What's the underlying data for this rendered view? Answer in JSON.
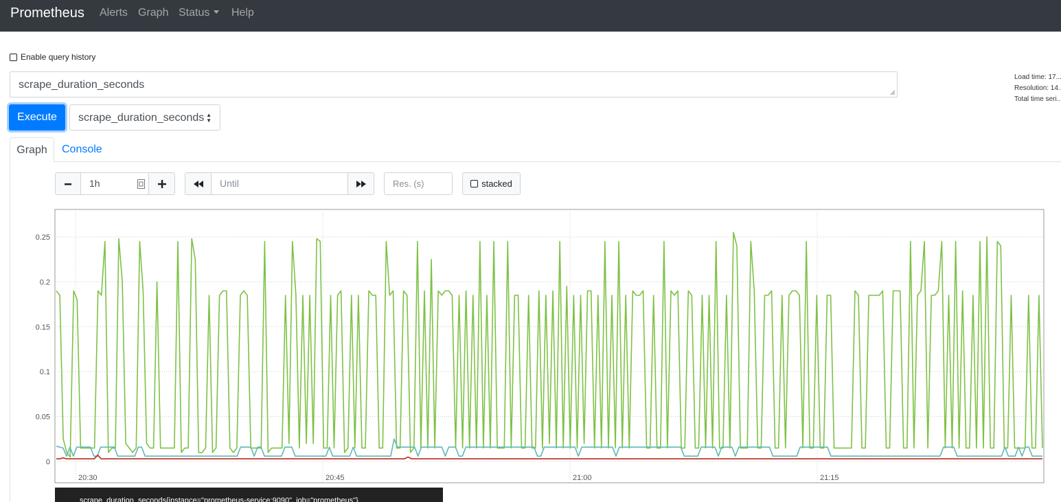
{
  "navbar": {
    "brand": "Prometheus",
    "links": [
      "Alerts",
      "Graph",
      "Status",
      "Help"
    ]
  },
  "query_history": {
    "label": "Enable query history",
    "checked": false
  },
  "expression": {
    "value": "scrape_duration_seconds"
  },
  "execute": {
    "label": "Execute"
  },
  "metric_select": {
    "value": "scrape_duration_seconds"
  },
  "stats": {
    "load_time": "Load time: 17...",
    "resolution": "Resolution: 14...",
    "total_series": "Total time seri..."
  },
  "tabs": {
    "graph": "Graph",
    "console": "Console"
  },
  "graph_controls": {
    "range": "1h",
    "until_placeholder": "Until",
    "res_placeholder": "Res. (s)",
    "stacked_label": "stacked"
  },
  "legend": {
    "text": "scrape_duration_seconds{instance=\"prometheus-service:9090\", job=\"prometheus\"}"
  },
  "colors": {
    "green": "#7dc145",
    "teal": "#5fb9b4",
    "red": "#c0392b",
    "navbar": "#343a40",
    "primary": "#007bff"
  },
  "chart_data": {
    "type": "line",
    "x_tick_labels": [
      "20:30",
      "20:45",
      "21:00",
      "21:15"
    ],
    "y_tick_labels": [
      "0",
      "0.05",
      "0.1",
      "0.15",
      "0.2",
      "0.25"
    ],
    "ylim": [
      0,
      0.28
    ],
    "grid": true,
    "x_start": "20:27",
    "x_step_seconds": 15,
    "series": [
      {
        "color": "#7dc145",
        "values": [
          0.19,
          0.185,
          0.025,
          0.01,
          0.005,
          0.19,
          0.18,
          0.015,
          0.015,
          0.015,
          0.015,
          0.015,
          0.19,
          0.185,
          0.245,
          0.01,
          0.015,
          0.015,
          0.248,
          0.2,
          0.02,
          0.015,
          0.01,
          0.015,
          0.245,
          0.19,
          0.02,
          0.015,
          0.015,
          0.2,
          0.015,
          0.015,
          0.015,
          0.015,
          0.015,
          0.245,
          0.01,
          0.015,
          0.015,
          0.248,
          0.225,
          0.01,
          0.01,
          0.015,
          0.185,
          0.01,
          0.015,
          0.185,
          0.19,
          0.19,
          0.015,
          0.01,
          0.015,
          0.185,
          0.19,
          0.185,
          0.015,
          0.015,
          0.015,
          0.015,
          0.245,
          0.01,
          0.015,
          0.015,
          0.015,
          0.015,
          0.185,
          0.02,
          0.245,
          0.185,
          0.015,
          0.185,
          0.02,
          0.185,
          0.02,
          0.248,
          0.245,
          0.015,
          0.015,
          0.185,
          0.015,
          0.185,
          0.19,
          0.01,
          0.015,
          0.185,
          0.015,
          0.185,
          0.015,
          0.015,
          0.19,
          0.185,
          0.185,
          0.015,
          0.015,
          0.245,
          0.185,
          0.19,
          0.015,
          0.015,
          0.19,
          0.185,
          0.01,
          0.015,
          0.245,
          0.015,
          0.19,
          0.015,
          0.225,
          0.015,
          0.19,
          0.185,
          0.19,
          0.19,
          0.185,
          0.015,
          0.185,
          0.015,
          0.19,
          0.015,
          0.185,
          0.015,
          0.245,
          0.015,
          0.185,
          0.015,
          0.245,
          0.015,
          0.015,
          0.015,
          0.245,
          0.015,
          0.185,
          0.185,
          0.015,
          0.015,
          0.185,
          0.015,
          0.015,
          0.19,
          0.015,
          0.185,
          0.02,
          0.19,
          0.015,
          0.245,
          0.015,
          0.195,
          0.015,
          0.185,
          0.015,
          0.185,
          0.02,
          0.19,
          0.19,
          0.015,
          0.185,
          0.015,
          0.245,
          0.015,
          0.185,
          0.015,
          0.245,
          0.015,
          0.185,
          0.015,
          0.19,
          0.185,
          0.185,
          0.19,
          0.015,
          0.015,
          0.185,
          0.015,
          0.015,
          0.245,
          0.015,
          0.19,
          0.185,
          0.19,
          0.015,
          0.015,
          0.19,
          0.185,
          0.015,
          0.015,
          0.185,
          0.015,
          0.185,
          0.015,
          0.245,
          0.015,
          0.015,
          0.185,
          0.015,
          0.255,
          0.24,
          0.015,
          0.015,
          0.015,
          0.245,
          0.19,
          0.015,
          0.015,
          0.185,
          0.185,
          0.19,
          0.015,
          0.015,
          0.185,
          0.015,
          0.185,
          0.19,
          0.19,
          0.185,
          0.015,
          0.245,
          0.015,
          0.015,
          0.185,
          0.015,
          0.015,
          0.185,
          0.185,
          0.015,
          0.015,
          0.015,
          0.015,
          0.015,
          0.015,
          0.19,
          0.185,
          0.015,
          0.015,
          0.185,
          0.185,
          0.185,
          0.185,
          0.19,
          0.015,
          0.015,
          0.19,
          0.19,
          0.19,
          0.015,
          0.015,
          0.245,
          0.015,
          0.185,
          0.19,
          0.245,
          0.015,
          0.185,
          0.185,
          0.19,
          0.245,
          0.015,
          0.185,
          0.015,
          0.245,
          0.015,
          0.19,
          0.015,
          0.015,
          0.185,
          0.015,
          0.245,
          0.015,
          0.25,
          0.015,
          0.015,
          0.245,
          0.24,
          0.015,
          0.015,
          0.185,
          0.015,
          0.015,
          0.015,
          0.015,
          0.185,
          0.015,
          0.015,
          0.185,
          0.015
        ]
      },
      {
        "color": "#5fb9b4",
        "values": [
          0.017,
          0.016,
          0.015,
          0.006,
          0.016,
          0.006,
          0.016,
          0.016,
          0.016,
          0.016,
          0.016,
          0.006,
          0.006,
          0.016,
          0.016,
          0.016,
          0.016,
          0.016,
          0.006,
          0.006,
          0.006,
          0.006,
          0.006,
          0.006,
          0.016,
          0.016,
          0.006,
          0.006,
          0.006,
          0.006,
          0.006,
          0.006,
          0.006,
          0.006,
          0.006,
          0.006,
          0.006,
          0.006,
          0.006,
          0.006,
          0.006,
          0.006,
          0.006,
          0.006,
          0.006,
          0.006,
          0.006,
          0.006,
          0.006,
          0.006,
          0.006,
          0.006,
          0.006,
          0.006,
          0.016,
          0.016,
          0.016,
          0.016,
          0.006,
          0.016,
          0.016,
          0.006,
          0.006,
          0.006,
          0.006,
          0.006,
          0.006,
          0.016,
          0.016,
          0.016,
          0.006,
          0.006,
          0.006,
          0.006,
          0.006,
          0.006,
          0.006,
          0.006,
          0.006,
          0.006,
          0.016,
          0.006,
          0.006,
          0.006,
          0.006,
          0.006,
          0.006,
          0.016,
          0.006,
          0.006,
          0.006,
          0.006,
          0.006,
          0.006,
          0.006,
          0.006,
          0.006,
          0.006,
          0.006,
          0.025,
          0.016,
          0.016,
          0.016,
          0.016,
          0.016,
          0.016,
          0.006,
          0.016,
          0.016,
          0.016,
          0.016,
          0.016,
          0.016,
          0.016,
          0.006,
          0.016,
          0.016,
          0.016,
          0.006,
          0.006,
          0.016,
          0.016,
          0.016,
          0.016,
          0.016,
          0.016,
          0.016,
          0.016,
          0.016,
          0.016,
          0.016,
          0.016,
          0.016,
          0.016,
          0.016,
          0.016,
          0.016,
          0.016,
          0.016,
          0.016,
          0.016,
          0.006,
          0.006,
          0.016,
          0.016,
          0.016,
          0.016,
          0.016,
          0.016,
          0.016,
          0.016,
          0.016,
          0.016,
          0.006,
          0.016,
          0.016,
          0.016,
          0.016,
          0.016,
          0.016,
          0.016,
          0.016,
          0.016,
          0.016,
          0.006,
          0.016,
          0.016,
          0.016,
          0.016,
          0.016,
          0.016,
          0.016,
          0.016,
          0.016,
          0.016,
          0.016,
          0.016,
          0.016,
          0.016,
          0.016,
          0.016,
          0.016,
          0.016,
          0.016,
          0.006,
          0.006,
          0.006,
          0.006,
          0.006,
          0.016,
          0.016,
          0.016,
          0.016,
          0.016,
          0.006,
          0.016,
          0.016,
          0.016,
          0.016,
          0.006,
          0.016,
          0.016,
          0.016,
          0.016,
          0.016,
          0.016,
          0.016,
          0.016,
          0.016,
          0.016,
          0.006,
          0.006,
          0.006,
          0.006,
          0.006,
          0.006,
          0.006,
          0.006,
          0.016,
          0.016,
          0.016,
          0.016,
          0.016,
          0.016,
          0.016,
          0.016,
          0.016,
          0.006,
          0.006,
          0.006,
          0.006,
          0.006,
          0.006,
          0.006,
          0.006,
          0.006,
          0.006,
          0.006,
          0.006,
          0.006,
          0.006,
          0.006,
          0.006,
          0.006,
          0.006,
          0.006,
          0.006,
          0.006,
          0.006,
          0.006,
          0.006,
          0.006,
          0.006,
          0.006,
          0.006,
          0.006,
          0.006,
          0.006,
          0.006,
          0.006,
          0.016,
          0.016,
          0.016,
          0.016,
          0.006,
          0.006,
          0.006,
          0.006,
          0.006,
          0.006,
          0.006,
          0.006,
          0.006,
          0.006,
          0.006,
          0.006,
          0.006,
          0.006,
          0.016,
          0.006,
          0.006,
          0.006,
          0.016,
          0.006,
          0.016,
          0.016,
          0.006,
          0.006,
          0.006,
          0.006
        ]
      },
      {
        "color": "#c0392b",
        "values": [
          0.003,
          0.003,
          0.004,
          0.003,
          0.003,
          0.003,
          0.003,
          0.003,
          0.003,
          0.003,
          0.003,
          0.003,
          0.007,
          0.003,
          0.003,
          0.003,
          0.003,
          0.003,
          0.003,
          0.003,
          0.003,
          0.003,
          0.003,
          0.003,
          0.003,
          0.003,
          0.003,
          0.003,
          0.003,
          0.003,
          0.003,
          0.003,
          0.003,
          0.003,
          0.003,
          0.003,
          0.003,
          0.003,
          0.003,
          0.003,
          0.003,
          0.003,
          0.003,
          0.003,
          0.003,
          0.003,
          0.003,
          0.003,
          0.003,
          0.003,
          0.003,
          0.003,
          0.003,
          0.003,
          0.003,
          0.003,
          0.003,
          0.003,
          0.003,
          0.003,
          0.003,
          0.003,
          0.003,
          0.003,
          0.003,
          0.003,
          0.003,
          0.003,
          0.003,
          0.003,
          0.003,
          0.003,
          0.003,
          0.003,
          0.003,
          0.003,
          0.003,
          0.003,
          0.003,
          0.003,
          0.003,
          0.003,
          0.003,
          0.003,
          0.003,
          0.003,
          0.003,
          0.003,
          0.003,
          0.003,
          0.003,
          0.003,
          0.003,
          0.003,
          0.003,
          0.003,
          0.003,
          0.003,
          0.003,
          0.003,
          0.003,
          0.003,
          0.005,
          0.003,
          0.003,
          0.003,
          0.003,
          0.003,
          0.003,
          0.003,
          0.003,
          0.003,
          0.003,
          0.003,
          0.003,
          0.003,
          0.003,
          0.003,
          0.003,
          0.003,
          0.003,
          0.003,
          0.003,
          0.003,
          0.003,
          0.003,
          0.003,
          0.003,
          0.003,
          0.003,
          0.003,
          0.003,
          0.003,
          0.003,
          0.003,
          0.003,
          0.003,
          0.003,
          0.003,
          0.003,
          0.003,
          0.003,
          0.003,
          0.003,
          0.003,
          0.003,
          0.003,
          0.003,
          0.003,
          0.003,
          0.003,
          0.003,
          0.003,
          0.003,
          0.003,
          0.003,
          0.003,
          0.003,
          0.003,
          0.003,
          0.003,
          0.003,
          0.003,
          0.003,
          0.003,
          0.003,
          0.003,
          0.003,
          0.003,
          0.003,
          0.003,
          0.003,
          0.003,
          0.003,
          0.003,
          0.003,
          0.003,
          0.003,
          0.003,
          0.003,
          0.003,
          0.003,
          0.003,
          0.003,
          0.003,
          0.003,
          0.003,
          0.003,
          0.003,
          0.003,
          0.003,
          0.003,
          0.003,
          0.003,
          0.003,
          0.003,
          0.003,
          0.003,
          0.003,
          0.003,
          0.003,
          0.003,
          0.003,
          0.003,
          0.003,
          0.003,
          0.003,
          0.003,
          0.003,
          0.003,
          0.003,
          0.003,
          0.003,
          0.003,
          0.003,
          0.003,
          0.003,
          0.003,
          0.003,
          0.003,
          0.003,
          0.003,
          0.003,
          0.003,
          0.003,
          0.003,
          0.003,
          0.003,
          0.003,
          0.003,
          0.003,
          0.003,
          0.003,
          0.003,
          0.003,
          0.003,
          0.003,
          0.003,
          0.003,
          0.003,
          0.003,
          0.003,
          0.003,
          0.003,
          0.003,
          0.003,
          0.003,
          0.003,
          0.003,
          0.003,
          0.003,
          0.003,
          0.003,
          0.003,
          0.003,
          0.003,
          0.003,
          0.003,
          0.003,
          0.003,
          0.003,
          0.003,
          0.003,
          0.003,
          0.003,
          0.003,
          0.003,
          0.003,
          0.003,
          0.003,
          0.003,
          0.003,
          0.003,
          0.003,
          0.003,
          0.003,
          0.003,
          0.003,
          0.003,
          0.003,
          0.003,
          0.003,
          0.003,
          0.003,
          0.003,
          0.003,
          0.003
        ]
      }
    ]
  }
}
